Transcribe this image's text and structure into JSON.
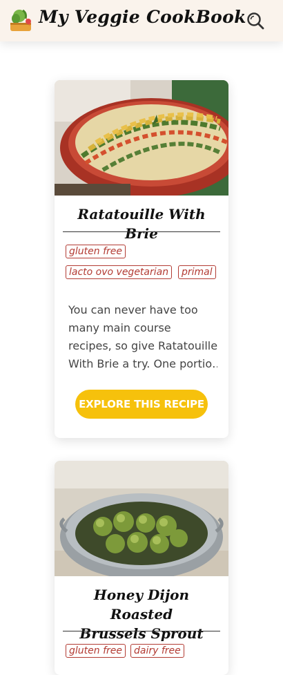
{
  "header": {
    "title": "My Veggie CookBook",
    "logo_icon": "vegetable-basket-icon",
    "search_icon": "search-icon"
  },
  "recipes": [
    {
      "title": "Ratatouille With Brie",
      "tags": [
        "gluten free",
        "lacto ovo vegetarian",
        "primal"
      ],
      "description_lines": [
        "You can never have too",
        "many main course",
        "recipes, so give Ratatouille",
        "With Brie a try. One portio…"
      ],
      "button_label": "Explore this recipe",
      "image": "ratatouille-dish-photo"
    },
    {
      "title_lines": [
        "Honey Dijon Roasted",
        "Brussels Sprout"
      ],
      "tags": [
        "gluten free",
        "dairy free"
      ],
      "image": "brussels-sprouts-photo"
    }
  ],
  "colors": {
    "header_bg": "#faf3ec",
    "accent": "#f6c10c",
    "tag": "#b23a32"
  }
}
